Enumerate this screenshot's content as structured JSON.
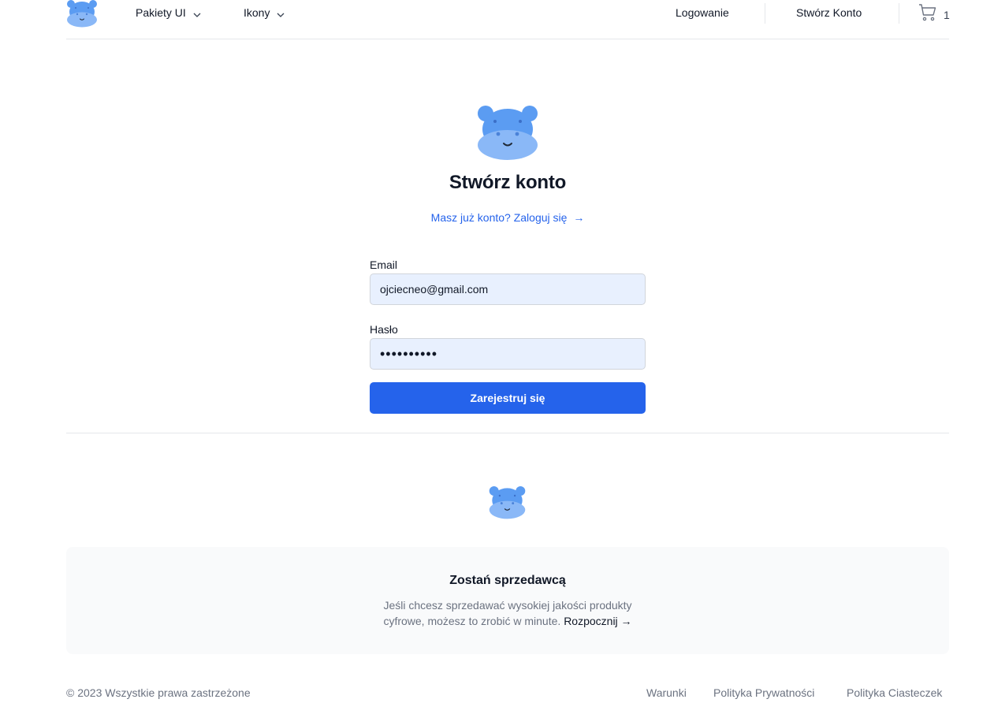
{
  "header": {
    "nav": [
      {
        "label": "Pakiety UI"
      },
      {
        "label": "Ikony"
      }
    ],
    "login_label": "Logowanie",
    "register_label": "Stwórz Konto",
    "cart_count": "1"
  },
  "main": {
    "title": "Stwórz konto",
    "have_account_link": "Masz już konto? Zaloguj się",
    "have_account_arrow": "→",
    "email_label": "Email",
    "email_value": "ojciecneo@gmail.com",
    "password_label": "Hasło",
    "password_value": "••••••••••",
    "submit_label": "Zarejestruj się"
  },
  "seller": {
    "title": "Zostań sprzedawcą",
    "text": "Jeśli chcesz sprzedawać wysokiej jakości produkty cyfrowe, możesz to zrobić w minute.",
    "link": "Rozpocznij →"
  },
  "footer": {
    "copyright": "© 2023 Wszystkie prawa zastrzeżone",
    "links": [
      {
        "label": "Warunki"
      },
      {
        "label": "Polityka Prywatności"
      },
      {
        "label": "Polityka Ciasteczek"
      }
    ]
  },
  "colors": {
    "accent": "#2563eb",
    "mascot": "#60a5fa",
    "input_bg": "#e8f0fe"
  },
  "icons": [
    "hippo-logo-icon",
    "chevron-down-icon",
    "cart-icon",
    "arrow-right-icon"
  ]
}
